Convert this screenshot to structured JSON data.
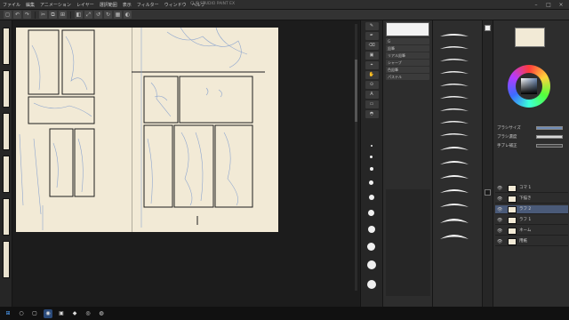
{
  "menu": {
    "items": [
      "ファイル",
      "編集",
      "アニメーション",
      "レイヤー",
      "選択範囲",
      "表示",
      "フィルター",
      "ウィンドウ",
      "ヘルプ"
    ]
  },
  "window": {
    "title": "CLIP STUDIO PAINT EX",
    "minimize": "–",
    "maximize": "□",
    "close": "×"
  },
  "toolbar": {
    "buttons": [
      "◻",
      "↶",
      "↷",
      "✂",
      "⧉",
      "⊞",
      "◧",
      "⤢",
      "↺",
      "↻",
      "▦",
      "◐"
    ]
  },
  "tools": {
    "labels": [
      "✎",
      "✒",
      "⌫",
      "▣",
      "⌖",
      "✋",
      "⊙",
      "A",
      "▭",
      "◓"
    ]
  },
  "subtool": {
    "rows": [
      "G",
      "鉛筆",
      "リアル鉛筆",
      "シャープ",
      "色鉛筆",
      "パステル"
    ]
  },
  "colors": {
    "main": "#f0f0f0",
    "sub": "#1a1a1a",
    "accent": "#6f8bb5",
    "paper": "#f2ead6"
  },
  "properties": {
    "rows": [
      "ブラシサイズ",
      "ブラシ濃度",
      "手ブレ補正"
    ]
  },
  "layers": {
    "rows": [
      {
        "eye": "👁",
        "name": "コマ 1"
      },
      {
        "eye": "👁",
        "name": "下描き"
      },
      {
        "eye": "👁",
        "name": "ラフ 2"
      },
      {
        "eye": "👁",
        "name": "ラフ 1"
      },
      {
        "eye": "👁",
        "name": "ネーム"
      },
      {
        "eye": "👁",
        "name": "用紙"
      }
    ]
  },
  "taskbar": {
    "icons": [
      "⊞",
      "○",
      "▢",
      "◉",
      "▣",
      "◆",
      "◎",
      "◍"
    ],
    "time": "",
    "date": ""
  }
}
